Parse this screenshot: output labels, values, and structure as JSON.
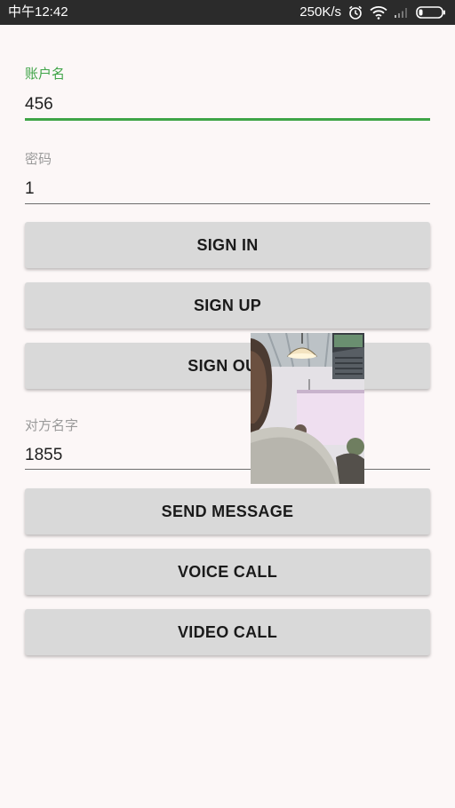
{
  "status_bar": {
    "time": "中午12:42",
    "net_speed": "250K/s",
    "icons": [
      "alarm-icon",
      "wifi-icon",
      "signal-icon",
      "battery-icon"
    ]
  },
  "form": {
    "account": {
      "label": "账户名",
      "value": "456"
    },
    "password": {
      "label": "密码",
      "value": "1"
    },
    "peer": {
      "label": "对方名字",
      "value": "1855"
    }
  },
  "buttons": {
    "sign_in": "SIGN IN",
    "sign_up": "SIGN UP",
    "sign_out": "SIGN OUT",
    "send_message": "SEND MESSAGE",
    "voice_call": "VOICE CALL",
    "video_call": "VIDEO CALL"
  },
  "colors": {
    "accent": "#3fa447",
    "background": "#fcf7f7",
    "button": "#d9d9d9",
    "status_bar": "#2b2b2b"
  }
}
